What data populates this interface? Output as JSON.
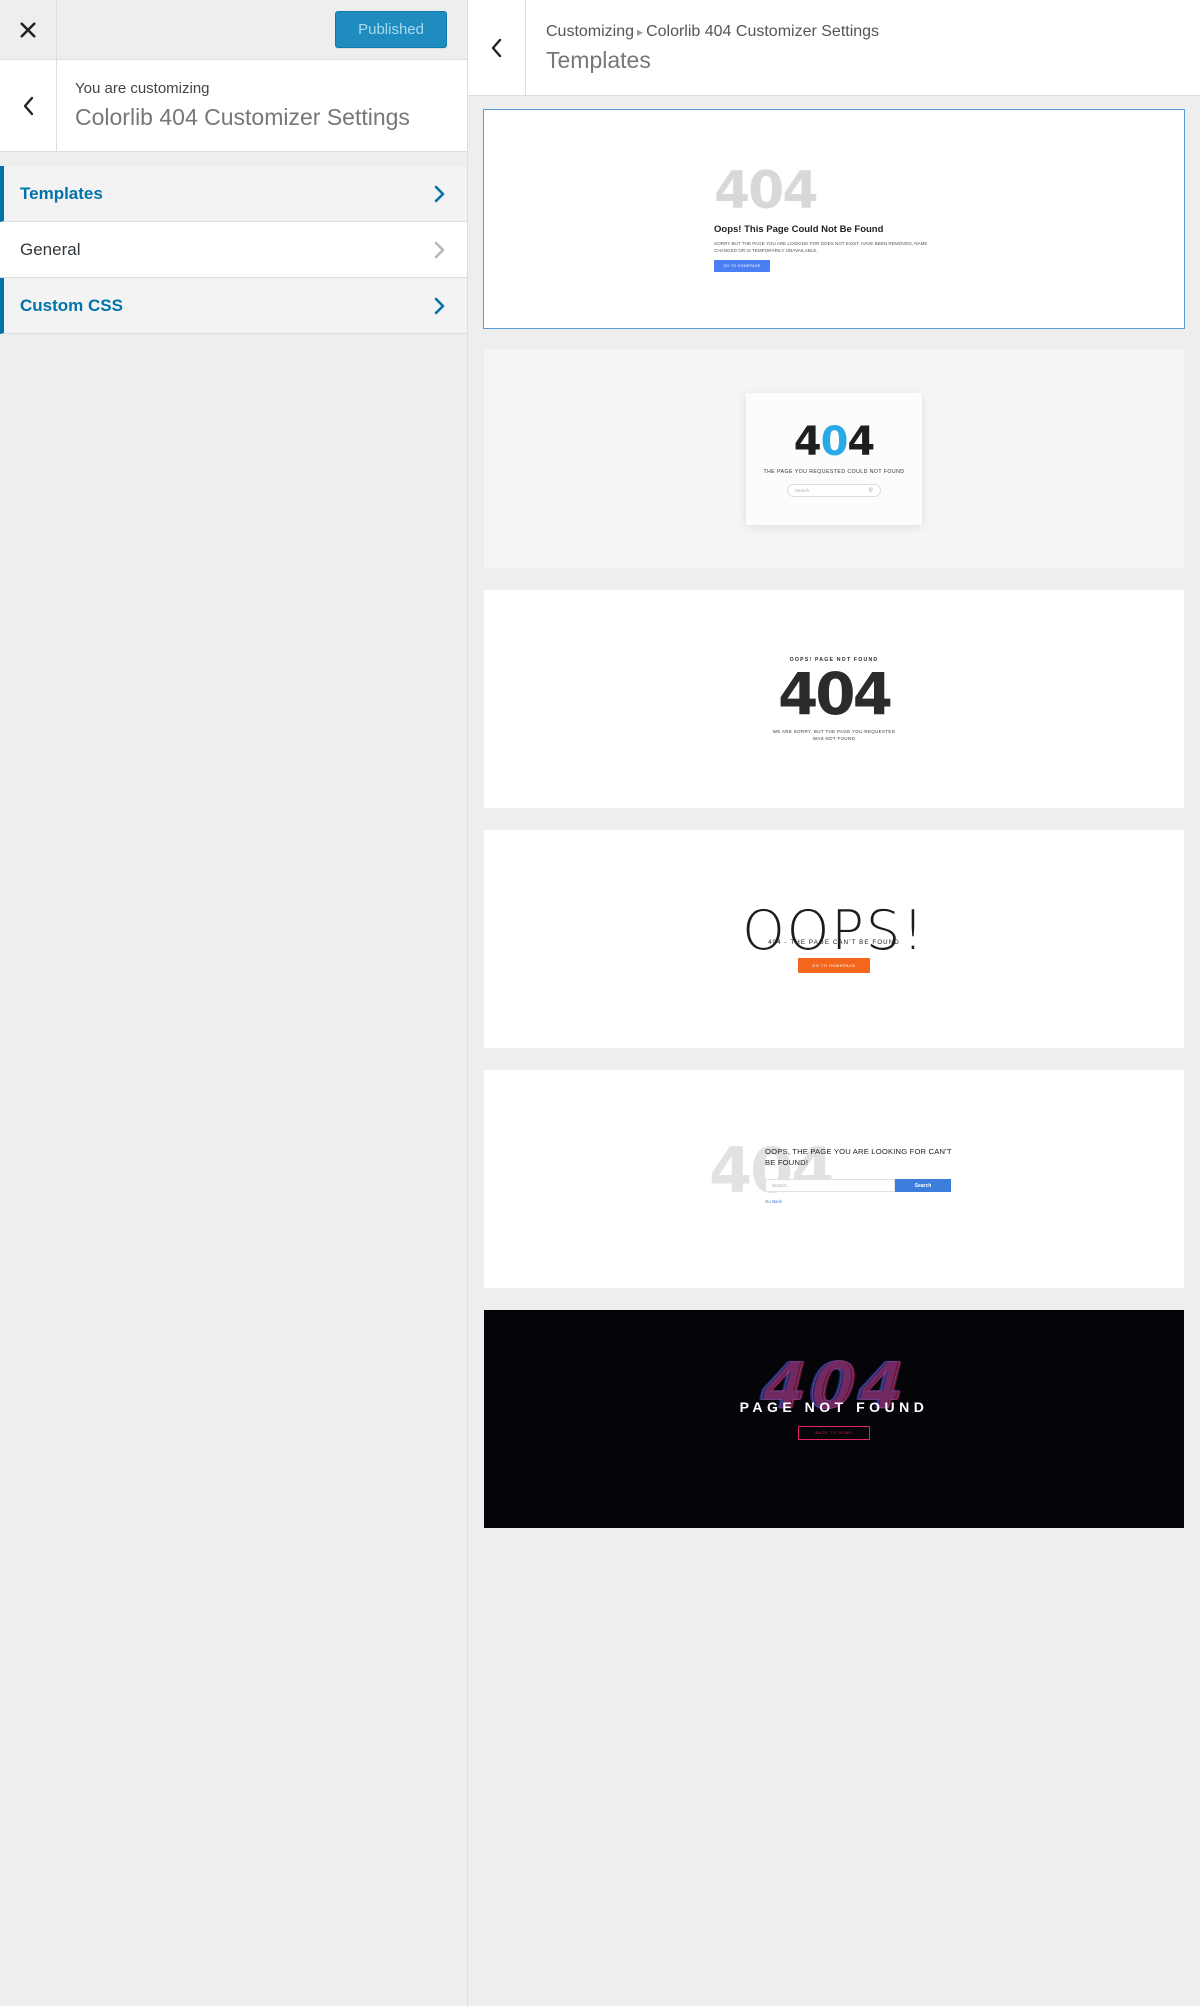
{
  "customizer": {
    "close_icon": "close-icon",
    "publish_button": "Published",
    "subtitle": "You are customizing",
    "title": "Colorlib 404 Customizer Settings",
    "back_icon": "chevron-left-icon",
    "menu": [
      {
        "label": "Templates",
        "icon": "chevron-right-icon",
        "active": true
      },
      {
        "label": "General",
        "icon": "chevron-right-icon",
        "active": false
      },
      {
        "label": "Custom CSS",
        "icon": "chevron-right-icon",
        "active": true
      }
    ]
  },
  "preview": {
    "back_icon": "chevron-left-icon",
    "breadcrumb_root": "Customizing",
    "breadcrumb_separator": "▸",
    "breadcrumb_current": "Colorlib 404 Customizer Settings",
    "section_title": "Templates"
  },
  "templates": [
    {
      "name": "template-1",
      "selected": true,
      "code": "404",
      "heading": "Oops! This Page Could Not Be Found",
      "body": "SORRY BUT THE PAGE YOU ARE LOOKING FOR DOES NOT EXIST, HAVE BEEN REMOVED, NAME CHANGED OR IS TEMPORARILY UNAVAILABLE.",
      "button": "GO TO HOMEPAGE",
      "button_color": "#4c7ef3"
    },
    {
      "name": "template-2",
      "selected": false,
      "code_part1": "4",
      "code_accent": "0",
      "code_part2": "4",
      "accent_color": "#29a9e8",
      "subtitle": "THE PAGE YOU REQUESTED COULD NOT FOUND",
      "search_placeholder": "Search",
      "search_icon": "magnifier-icon"
    },
    {
      "name": "template-3",
      "selected": false,
      "top_label": "OOPS! PAGE NOT FOUND",
      "code": "404",
      "subtitle": "WE ARE SORRY, BUT THE PAGE YOU REQUESTED WAS NOT FOUND"
    },
    {
      "name": "template-4",
      "selected": false,
      "headline": "OOPS!",
      "subtitle": "404 - THE PAGE CAN'T BE FOUND",
      "button": "GO TO HOMEPAGE",
      "button_color": "#f4661d"
    },
    {
      "name": "template-5",
      "selected": false,
      "ghost_code": "404",
      "heading": "OOPS, THE PAGE YOU ARE LOOKING FOR CAN'T BE FOUND!",
      "search_placeholder": "Search...",
      "search_button": "Search",
      "back_link": "Go Back",
      "accent_color": "#3d7ddb"
    },
    {
      "name": "template-6",
      "selected": false,
      "ghost_code": "404",
      "title": "PAGE NOT FOUND",
      "button": "BACK TO HOME",
      "background": "#050509",
      "accent_color": "#e0265c"
    }
  ]
}
